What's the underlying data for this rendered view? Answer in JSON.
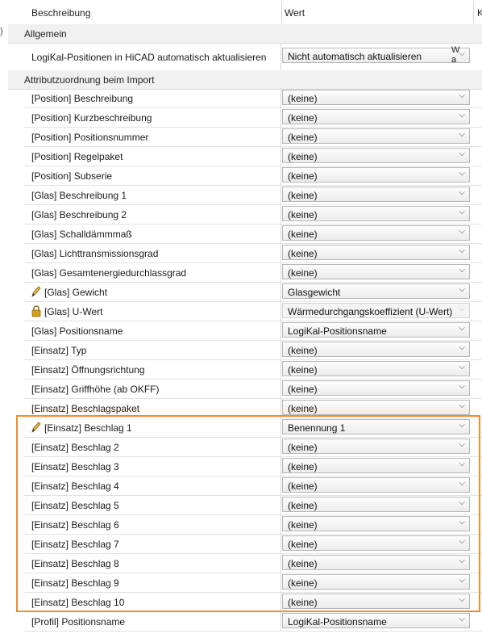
{
  "header": {
    "col1": "Beschreibung",
    "col2": "Wert",
    "col3": "K"
  },
  "gutter_mark": ")",
  "sections": {
    "general": "Allgemein",
    "import": "Attributzuordnung beim Import"
  },
  "general_row": {
    "label": "LogiKal-Positionen in HiCAD automatisch aktualisieren",
    "value": "Nicht automatisch aktualisieren",
    "overflow_line1": "W",
    "overflow_line2": "a"
  },
  "rows": [
    {
      "label": "[Position] Beschreibung",
      "value": "(keine)"
    },
    {
      "label": "[Position] Kurzbeschreibung",
      "value": "(keine)"
    },
    {
      "label": "[Position] Positionsnummer",
      "value": "(keine)"
    },
    {
      "label": "[Position] Regelpaket",
      "value": "(keine)"
    },
    {
      "label": "[Position] Subserie",
      "value": "(keine)"
    },
    {
      "label": "[Glas] Beschreibung 1",
      "value": "(keine)"
    },
    {
      "label": "[Glas] Beschreibung 2",
      "value": "(keine)"
    },
    {
      "label": "[Glas] Schalldämmmaß",
      "value": "(keine)"
    },
    {
      "label": "[Glas] Lichttransmissionsgrad",
      "value": "(keine)"
    },
    {
      "label": "[Glas] Gesamtenergiedurchlassgrad",
      "value": "(keine)"
    },
    {
      "label": "[Glas] Gewicht",
      "value": "Glasgewicht",
      "icon": "pencil-icon"
    },
    {
      "label": "[Glas] U-Wert",
      "value": "Wärmedurchgangskoeffizient (U-Wert)",
      "icon": "lock-icon",
      "disabled": true
    },
    {
      "label": "[Glas] Positionsname",
      "value": "LogiKal-Positionsname"
    },
    {
      "label": "[Einsatz] Typ",
      "value": "(keine)"
    },
    {
      "label": "[Einsatz] Öffnungsrichtung",
      "value": "(keine)"
    },
    {
      "label": "[Einsatz] Griffhöhe (ab OKFF)",
      "value": "(keine)"
    },
    {
      "label": "[Einsatz] Beschlagspaket",
      "value": "(keine)"
    },
    {
      "label": "[Einsatz] Beschlag 1",
      "value": "Benennung 1",
      "icon": "pencil-icon"
    },
    {
      "label": "[Einsatz] Beschlag 2",
      "value": "(keine)"
    },
    {
      "label": "[Einsatz] Beschlag 3",
      "value": "(keine)"
    },
    {
      "label": "[Einsatz] Beschlag 4",
      "value": "(keine)"
    },
    {
      "label": "[Einsatz] Beschlag 5",
      "value": "(keine)"
    },
    {
      "label": "[Einsatz] Beschlag 6",
      "value": "(keine)"
    },
    {
      "label": "[Einsatz] Beschlag 7",
      "value": "(keine)"
    },
    {
      "label": "[Einsatz] Beschlag 8",
      "value": "(keine)"
    },
    {
      "label": "[Einsatz] Beschlag 9",
      "value": "(keine)"
    },
    {
      "label": "[Einsatz] Beschlag 10",
      "value": "(keine)"
    },
    {
      "label": "[Profil] Positionsname",
      "value": "LogiKal-Positionsname"
    }
  ],
  "colors": {
    "highlight": "#f28c28",
    "section_bg": "#f0f0f0",
    "lock": "#d4a017"
  }
}
